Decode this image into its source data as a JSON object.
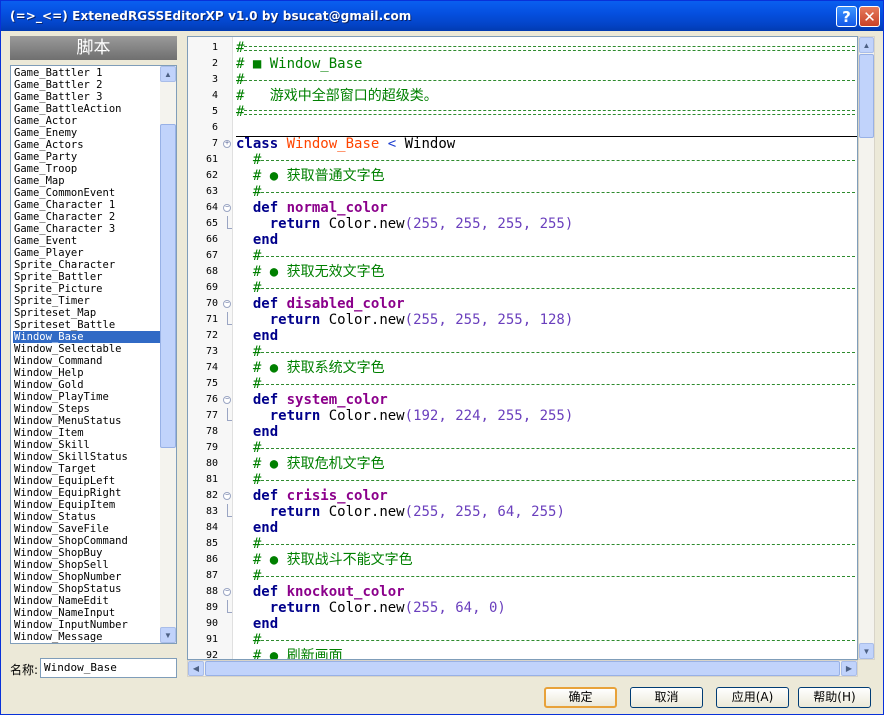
{
  "window": {
    "title": "(=>_<=) ExtenedRGSSEditorXP v1.0 by bsucat@gmail.com",
    "help_glyph": "?",
    "close_glyph": "✕"
  },
  "sidebar": {
    "header": "脚本",
    "selected": "Window_Base",
    "items": [
      "Game_Battler 1",
      "Game_Battler 2",
      "Game_Battler 3",
      "Game_BattleAction",
      "Game_Actor",
      "Game_Enemy",
      "Game_Actors",
      "Game_Party",
      "Game_Troop",
      "Game_Map",
      "Game_CommonEvent",
      "Game_Character 1",
      "Game_Character 2",
      "Game_Character 3",
      "Game_Event",
      "Game_Player",
      "Sprite_Character",
      "Sprite_Battler",
      "Sprite_Picture",
      "Sprite_Timer",
      "Spriteset_Map",
      "Spriteset_Battle",
      "Window_Base",
      "Window_Selectable",
      "Window_Command",
      "Window_Help",
      "Window_Gold",
      "Window_PlayTime",
      "Window_Steps",
      "Window_MenuStatus",
      "Window_Item",
      "Window_Skill",
      "Window_SkillStatus",
      "Window_Target",
      "Window_EquipLeft",
      "Window_EquipRight",
      "Window_EquipItem",
      "Window_Status",
      "Window_SaveFile",
      "Window_ShopCommand",
      "Window_ShopBuy",
      "Window_ShopSell",
      "Window_ShopNumber",
      "Window_ShopStatus",
      "Window_NameEdit",
      "Window_NameInput",
      "Window_InputNumber",
      "Window_Message"
    ],
    "name_label": "名称:",
    "name_value": "Window_Base"
  },
  "editor": {
    "lines": [
      {
        "n": "1",
        "kind": "rule2",
        "text": "#"
      },
      {
        "n": "2",
        "kind": "comment",
        "text": "# ■ Window_Base"
      },
      {
        "n": "3",
        "kind": "rule",
        "text": "#"
      },
      {
        "n": "4",
        "kind": "comment",
        "text": "#   游戏中全部窗口的超级类。"
      },
      {
        "n": "5",
        "kind": "rule2",
        "text": "#"
      },
      {
        "n": "6",
        "kind": "blank",
        "text": ""
      },
      {
        "n": "7",
        "kind": "class",
        "text": "class Window_Base < Window"
      },
      {
        "n": "61",
        "kind": "rule",
        "text": "#"
      },
      {
        "n": "62",
        "kind": "comment",
        "text": "# ● 获取普通文字色"
      },
      {
        "n": "63",
        "kind": "rule",
        "text": "#"
      },
      {
        "n": "64",
        "kind": "def",
        "text": "def normal_color"
      },
      {
        "n": "65",
        "kind": "ret",
        "text": "return Color.new(255, 255, 255, 255)"
      },
      {
        "n": "66",
        "kind": "end",
        "text": "end"
      },
      {
        "n": "67",
        "kind": "rule",
        "text": "#"
      },
      {
        "n": "68",
        "kind": "comment",
        "text": "# ● 获取无效文字色"
      },
      {
        "n": "69",
        "kind": "rule",
        "text": "#"
      },
      {
        "n": "70",
        "kind": "def",
        "text": "def disabled_color"
      },
      {
        "n": "71",
        "kind": "ret",
        "text": "return Color.new(255, 255, 255, 128)"
      },
      {
        "n": "72",
        "kind": "end",
        "text": "end"
      },
      {
        "n": "73",
        "kind": "rule",
        "text": "#"
      },
      {
        "n": "74",
        "kind": "comment",
        "text": "# ● 获取系统文字色"
      },
      {
        "n": "75",
        "kind": "rule",
        "text": "#"
      },
      {
        "n": "76",
        "kind": "def",
        "text": "def system_color"
      },
      {
        "n": "77",
        "kind": "ret",
        "text": "return Color.new(192, 224, 255, 255)"
      },
      {
        "n": "78",
        "kind": "end",
        "text": "end"
      },
      {
        "n": "79",
        "kind": "rule",
        "text": "#"
      },
      {
        "n": "80",
        "kind": "comment",
        "text": "# ● 获取危机文字色"
      },
      {
        "n": "81",
        "kind": "rule",
        "text": "#"
      },
      {
        "n": "82",
        "kind": "def",
        "text": "def crisis_color"
      },
      {
        "n": "83",
        "kind": "ret",
        "text": "return Color.new(255, 255, 64, 255)"
      },
      {
        "n": "84",
        "kind": "end",
        "text": "end"
      },
      {
        "n": "85",
        "kind": "rule",
        "text": "#"
      },
      {
        "n": "86",
        "kind": "comment",
        "text": "# ● 获取战斗不能文字色"
      },
      {
        "n": "87",
        "kind": "rule",
        "text": "#"
      },
      {
        "n": "88",
        "kind": "def",
        "text": "def knockout_color"
      },
      {
        "n": "89",
        "kind": "ret",
        "text": "return Color.new(255, 64, 0)"
      },
      {
        "n": "90",
        "kind": "end",
        "text": "end"
      },
      {
        "n": "91",
        "kind": "rule",
        "text": "#"
      },
      {
        "n": "92",
        "kind": "comment",
        "text": "# ● 刷新画面"
      }
    ]
  },
  "buttons": {
    "ok": "确定",
    "cancel": "取消",
    "apply": "应用(A)",
    "help": "帮助(H)"
  },
  "colors": {
    "title_bar": "#0550e0",
    "selection": "#316ac5",
    "comment": "#008000",
    "keyword": "#00008b",
    "method": "#8b008b",
    "class_name": "#ff4500",
    "number": "#6a3fbd"
  }
}
